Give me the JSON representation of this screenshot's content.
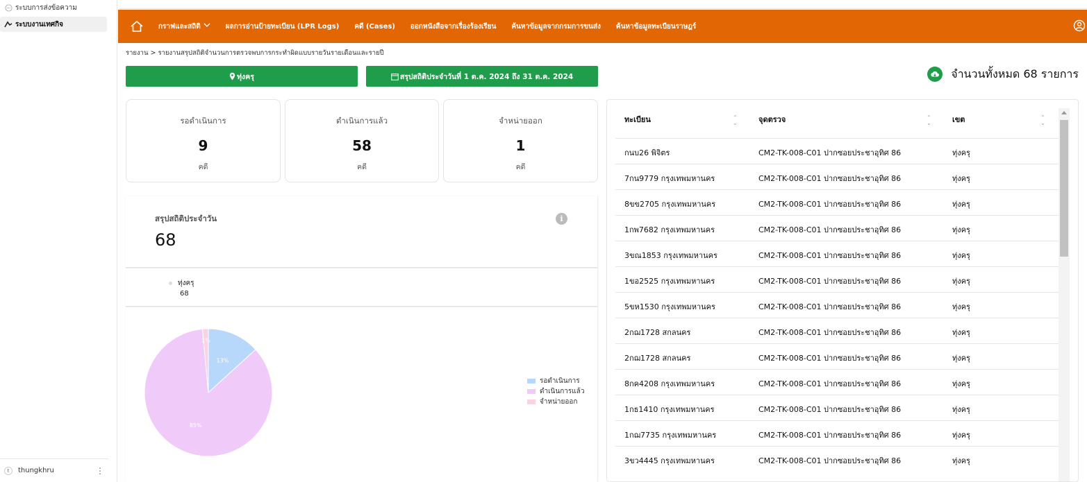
{
  "sidebar": {
    "items": [
      {
        "label": "ระบบการส่งข้อความ",
        "icon": "chat-icon"
      },
      {
        "label": "ระบบงานเทศกิจ",
        "icon": "logo-icon"
      }
    ],
    "user": {
      "initial": "t",
      "name": "thungkhru"
    }
  },
  "navbar": {
    "items": [
      {
        "label": "กราฟและสถิติ",
        "has_dropdown": true
      },
      {
        "label": "ผลการอ่านป้ายทะเบียน (LPR Logs)"
      },
      {
        "label": "คดี (Cases)"
      },
      {
        "label": "ออกหนังสือจากเรื่องร้องเรียน"
      },
      {
        "label": "ค้นหาข้อมูลจากกรมการขนส่ง"
      },
      {
        "label": "ค้นหาข้อมูลทะเบียนราษฎร์"
      }
    ],
    "color": "#e26603"
  },
  "breadcrumb": "รายงาน > รายงานสรุปสถิติจำนวนการตรวจพบการกระทำผิดแบบรายวันรายเดือนและรายปี",
  "filters": {
    "district": "ทุ่งครุ",
    "date_range": "สรุปสถิติประจำวันที่ 1 ต.ค. 2024 ถึง 31 ต.ค. 2024"
  },
  "total": "จำนวนทั้งหมด 68 รายการ",
  "stats": [
    {
      "label": "รอดำเนินการ",
      "value": "9",
      "unit": "คดี"
    },
    {
      "label": "ดำเนินการแล้ว",
      "value": "58",
      "unit": "คดี"
    },
    {
      "label": "จำหน่ายออก",
      "value": "1",
      "unit": "คดี"
    }
  ],
  "summary": {
    "title": "สรุปสถิติประจำวัน",
    "total": "68",
    "legend_top": {
      "label": "ทุ่งครุ",
      "value": "68"
    }
  },
  "chart_data": {
    "type": "pie",
    "categories": [
      "รอดำเนินการ",
      "ดำเนินการแล้ว",
      "จำหน่ายออก"
    ],
    "values": [
      9,
      58,
      1
    ],
    "labels": [
      "13%",
      "85%",
      "1%"
    ],
    "colors": [
      "#b7d7fb",
      "#f0cbfa",
      "#f9d3e4"
    ],
    "legend": "right"
  },
  "table": {
    "columns": [
      "ทะเบียน",
      "จุดตรวจ",
      "เขต"
    ],
    "rows": [
      [
        "กนบ26 พิจิตร",
        "CM2-TK-008-C01 ปากซอยประชาอุทิศ 86",
        "ทุ่งครุ"
      ],
      [
        "7กน9779 กรุงเทพมหานคร",
        "CM2-TK-008-C01 ปากซอยประชาอุทิศ 86",
        "ทุ่งครุ"
      ],
      [
        "8ขข2705 กรุงเทพมหานคร",
        "CM2-TK-008-C01 ปากซอยประชาอุทิศ 86",
        "ทุ่งครุ"
      ],
      [
        "1กพ7682 กรุงเทพมหานคร",
        "CM2-TK-008-C01 ปากซอยประชาอุทิศ 86",
        "ทุ่งครุ"
      ],
      [
        "3ขณ1853 กรุงเทพมหานคร",
        "CM2-TK-008-C01 ปากซอยประชาอุทิศ 86",
        "ทุ่งครุ"
      ],
      [
        "1ขอ2525 กรุงเทพมหานคร",
        "CM2-TK-008-C01 ปากซอยประชาอุทิศ 86",
        "ทุ่งครุ"
      ],
      [
        "5ขห1530 กรุงเทพมหานคร",
        "CM2-TK-008-C01 ปากซอยประชาอุทิศ 86",
        "ทุ่งครุ"
      ],
      [
        "2กฌ1728 สกลนคร",
        "CM2-TK-008-C01 ปากซอยประชาอุทิศ 86",
        "ทุ่งครุ"
      ],
      [
        "2กฌ1728 สกลนคร",
        "CM2-TK-008-C01 ปากซอยประชาอุทิศ 86",
        "ทุ่งครุ"
      ],
      [
        "8กค4208 กรุงเทพมหานคร",
        "CM2-TK-008-C01 ปากซอยประชาอุทิศ 86",
        "ทุ่งครุ"
      ],
      [
        "1กธ1410 กรุงเทพมหานคร",
        "CM2-TK-008-C01 ปากซอยประชาอุทิศ 86",
        "ทุ่งครุ"
      ],
      [
        "1กฌ7735 กรุงเทพมหานคร",
        "CM2-TK-008-C01 ปากซอยประชาอุทิศ 86",
        "ทุ่งครุ"
      ],
      [
        "3ขว4445 กรุงเทพมหานคร",
        "CM2-TK-008-C01 ปากซอยประชาอุทิศ 86",
        "ทุ่งครุ"
      ]
    ]
  }
}
